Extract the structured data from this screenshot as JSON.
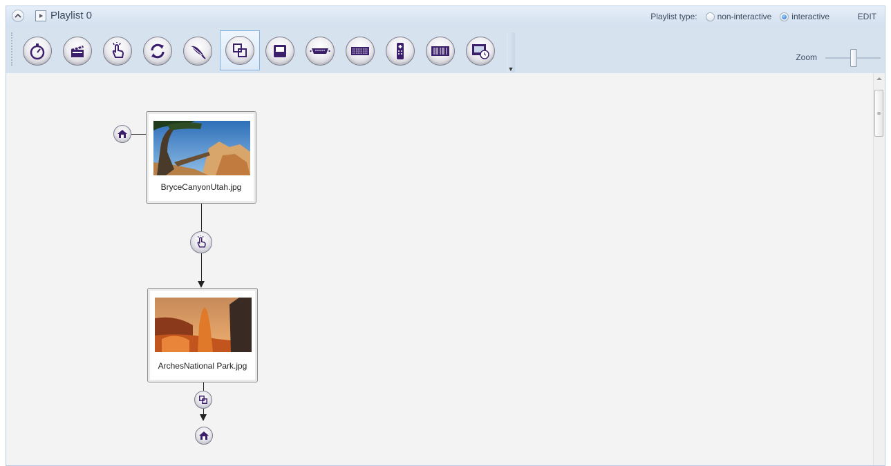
{
  "header": {
    "title": "Playlist 0",
    "playlist_type_label": "Playlist type:",
    "options": [
      "non-interactive",
      "interactive"
    ],
    "selected_option": "interactive",
    "edit_label": "EDIT"
  },
  "toolbar": {
    "buttons": [
      {
        "name": "timer-icon"
      },
      {
        "name": "clapperboard-icon"
      },
      {
        "name": "touch-hand-icon"
      },
      {
        "name": "refresh-icon"
      },
      {
        "name": "feather-icon"
      },
      {
        "name": "overlap-squares-icon",
        "selected": true
      },
      {
        "name": "monitor-icon"
      },
      {
        "name": "serial-port-icon"
      },
      {
        "name": "keyboard-icon"
      },
      {
        "name": "remote-control-icon"
      },
      {
        "name": "barcode-icon"
      },
      {
        "name": "timed-video-icon"
      }
    ],
    "zoom_label": "Zoom",
    "zoom_level": 0.55
  },
  "canvas": {
    "nodes": [
      {
        "filename": "BryceCanyonUtah.jpg"
      },
      {
        "filename": "ArchesNational Park.jpg"
      }
    ],
    "events": [
      {
        "icon": "home-icon"
      },
      {
        "icon": "touch-hand-icon"
      },
      {
        "icon": "overlap-squares-icon"
      },
      {
        "icon": "home-icon"
      }
    ]
  },
  "colors": {
    "toolbar_bg": "#d7e2ef",
    "canvas_bg": "#f3f3f3",
    "icon_purple": "#3b1f6b",
    "selection_border": "#7fb1e0"
  }
}
